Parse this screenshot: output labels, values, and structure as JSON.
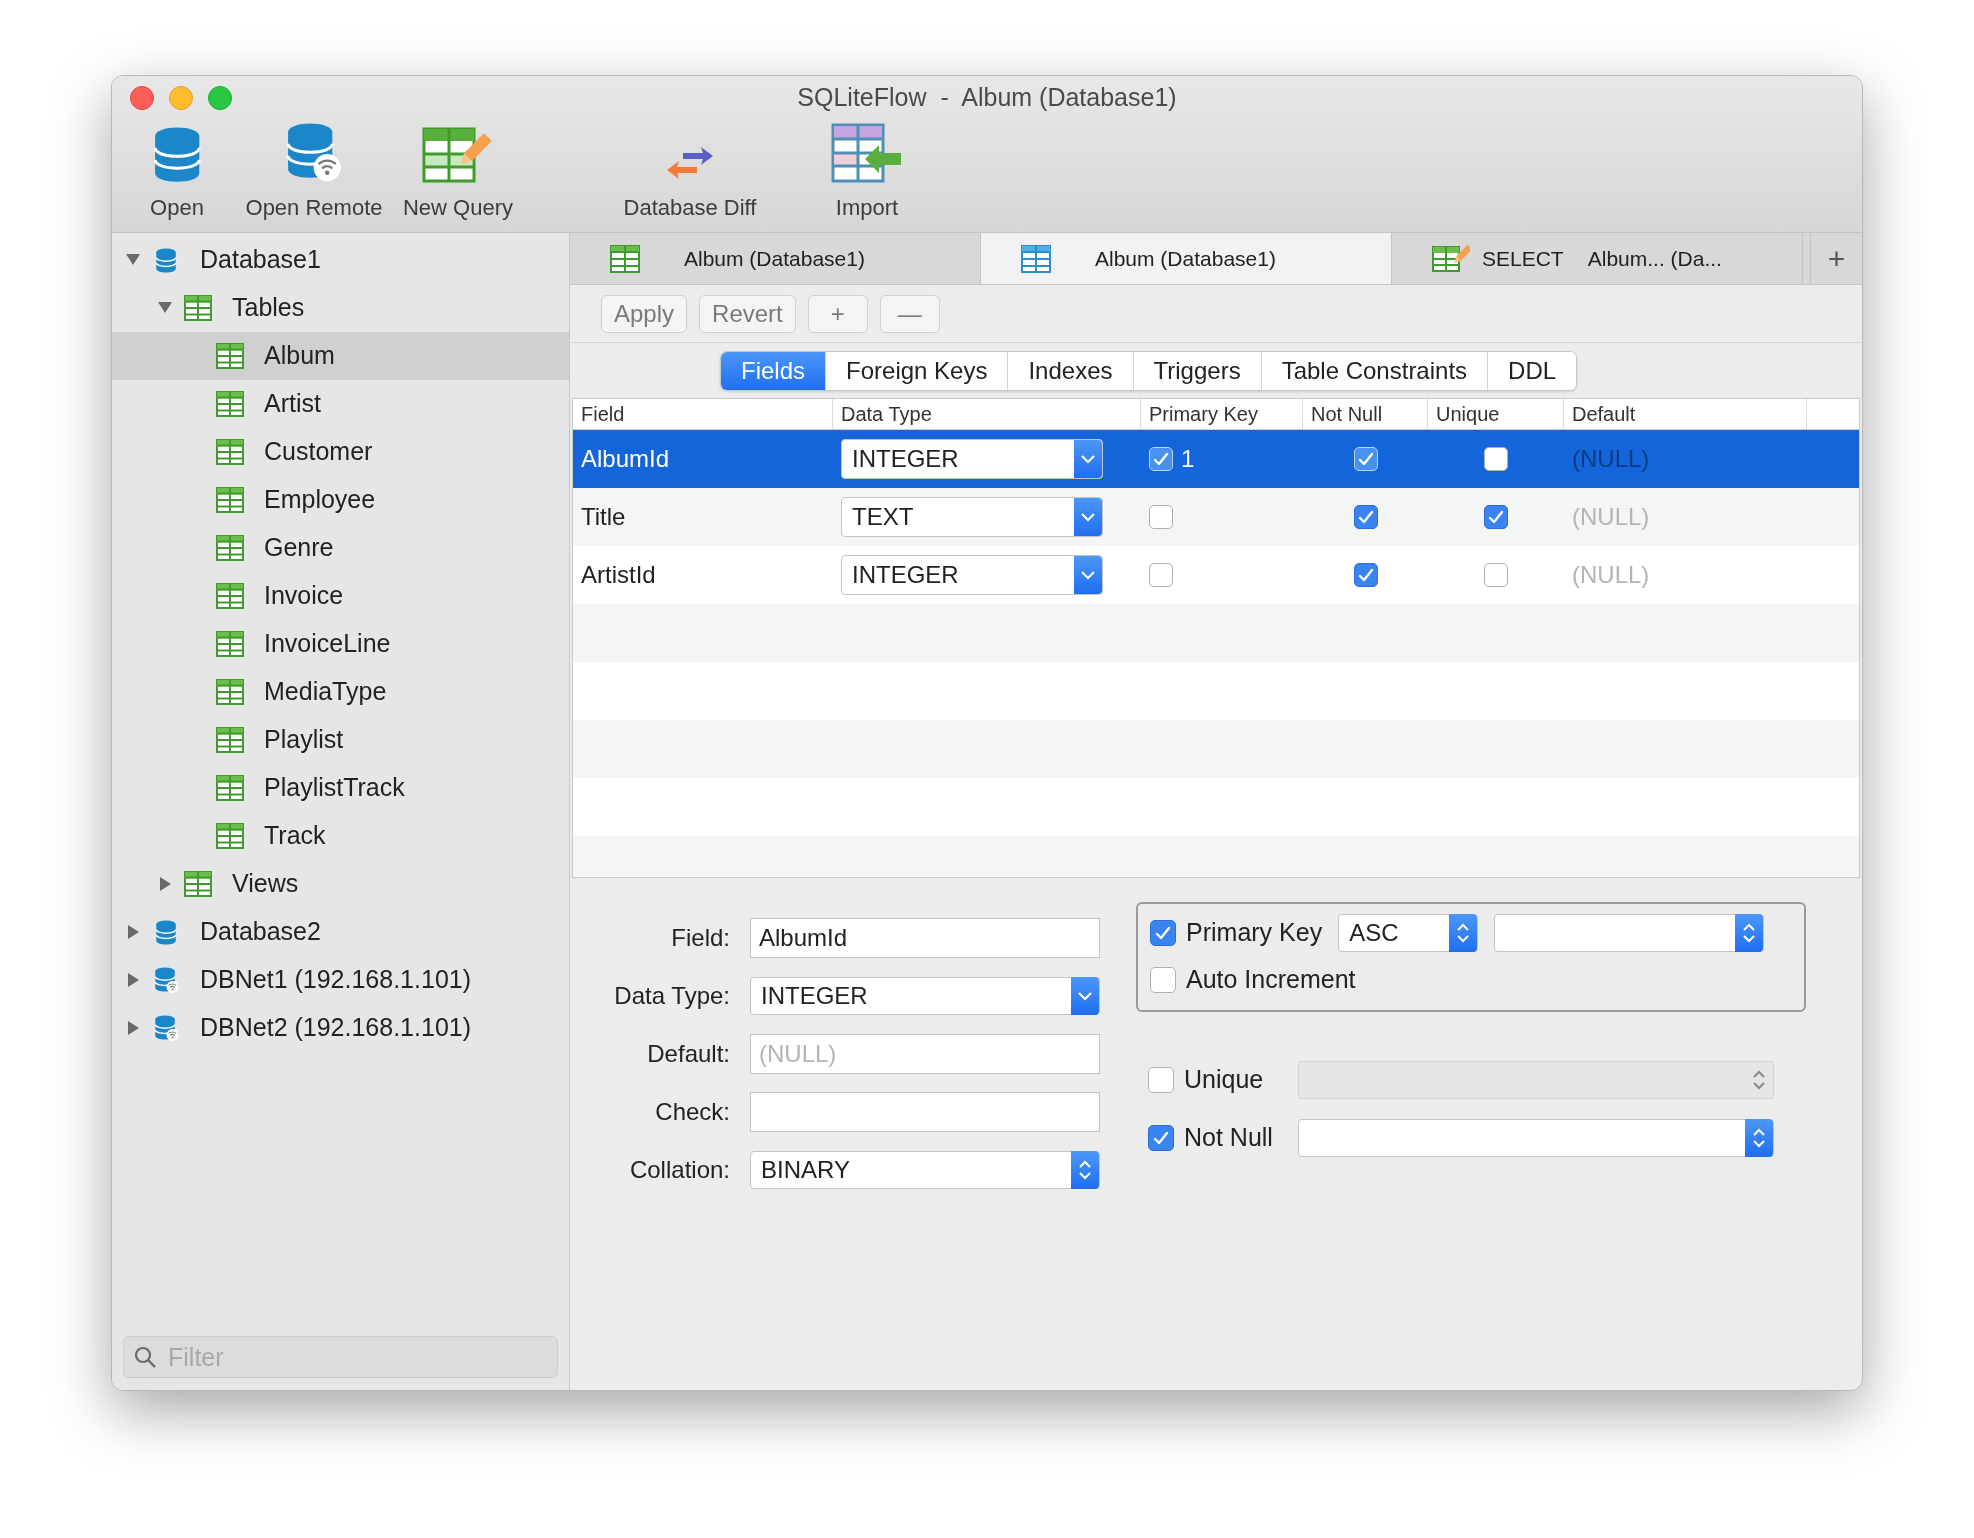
{
  "window": {
    "title": "SQLiteFlow  -  Album (Database1)"
  },
  "toolbar": [
    {
      "label": "Open",
      "kind": "database"
    },
    {
      "label": "Open Remote",
      "kind": "remote"
    },
    {
      "label": "New Query",
      "kind": "query"
    },
    {
      "label": "Database Diff",
      "kind": "diff"
    },
    {
      "label": "Import",
      "kind": "import"
    }
  ],
  "sidebar": {
    "tree": [
      {
        "label": "Database1",
        "kind": "database",
        "expanded": true,
        "selected": false,
        "children": [
          {
            "label": "Tables",
            "kind": "folder",
            "expanded": true,
            "selected": false,
            "children": [
              {
                "label": "Album",
                "kind": "table",
                "selected": true
              },
              {
                "label": "Artist",
                "kind": "table",
                "selected": false
              },
              {
                "label": "Customer",
                "kind": "table",
                "selected": false
              },
              {
                "label": "Employee",
                "kind": "table",
                "selected": false
              },
              {
                "label": "Genre",
                "kind": "table",
                "selected": false
              },
              {
                "label": "Invoice",
                "kind": "table",
                "selected": false
              },
              {
                "label": "InvoiceLine",
                "kind": "table",
                "selected": false
              },
              {
                "label": "MediaType",
                "kind": "table",
                "selected": false
              },
              {
                "label": "Playlist",
                "kind": "table",
                "selected": false
              },
              {
                "label": "PlaylistTrack",
                "kind": "table",
                "selected": false
              },
              {
                "label": "Track",
                "kind": "table",
                "selected": false
              }
            ]
          },
          {
            "label": "Views",
            "kind": "folder",
            "expanded": false,
            "selected": false
          }
        ]
      },
      {
        "label": "Database2",
        "kind": "database",
        "expanded": false,
        "selected": false
      },
      {
        "label": "DBNet1 (192.168.1.101)",
        "kind": "remote",
        "expanded": false,
        "selected": false
      },
      {
        "label": "DBNet2 (192.168.1.101)",
        "kind": "remote",
        "expanded": false,
        "selected": false
      }
    ],
    "filter": {
      "placeholder": "Filter"
    }
  },
  "tabs": [
    {
      "kind": "table",
      "label": "Album (Database1)",
      "selected": false
    },
    {
      "kind": "table",
      "label": "Album (Database1)",
      "selected": true
    },
    {
      "kind": "query",
      "prefix": "SELECT",
      "label": "Album... (Da...",
      "selected": false
    }
  ],
  "new_tab": "+",
  "actions": [
    "Apply",
    "Revert",
    "+",
    "—"
  ],
  "segments": [
    {
      "label": "Fields",
      "selected": true
    },
    {
      "label": "Foreign Keys",
      "selected": false
    },
    {
      "label": "Indexes",
      "selected": false
    },
    {
      "label": "Triggers",
      "selected": false
    },
    {
      "label": "Table Constraints",
      "selected": false
    },
    {
      "label": "DDL",
      "selected": false
    }
  ],
  "table": {
    "columns": [
      "Field",
      "Data Type",
      "Primary Key",
      "Not Null",
      "Unique",
      "Default"
    ],
    "rows": [
      {
        "field": "AlbumId",
        "data_type": "INTEGER",
        "primary_key": true,
        "pk_order": "1",
        "not_null": true,
        "unique": false,
        "default": "(NULL)",
        "selected": true
      },
      {
        "field": "Title",
        "data_type": "TEXT",
        "primary_key": false,
        "not_null": true,
        "unique": true,
        "default": "(NULL)",
        "selected": false
      },
      {
        "field": "ArtistId",
        "data_type": "INTEGER",
        "primary_key": false,
        "not_null": true,
        "unique": false,
        "default": "(NULL)",
        "selected": false
      }
    ]
  },
  "form": {
    "field": {
      "label": "Field:",
      "value": "AlbumId"
    },
    "data_type": {
      "label": "Data Type:",
      "value": "INTEGER"
    },
    "default": {
      "label": "Default:",
      "placeholder": "(NULL)"
    },
    "check": {
      "label": "Check:"
    },
    "collation": {
      "label": "Collation:",
      "value": "BINARY"
    },
    "primary_key": {
      "label": "Primary Key",
      "checked": true,
      "order": "ASC"
    },
    "auto_increment": {
      "label": "Auto Increment",
      "checked": false
    },
    "unique": {
      "label": "Unique",
      "checked": false,
      "select_disabled": true
    },
    "not_null": {
      "label": "Not Null",
      "checked": true,
      "select_disabled": false
    }
  }
}
